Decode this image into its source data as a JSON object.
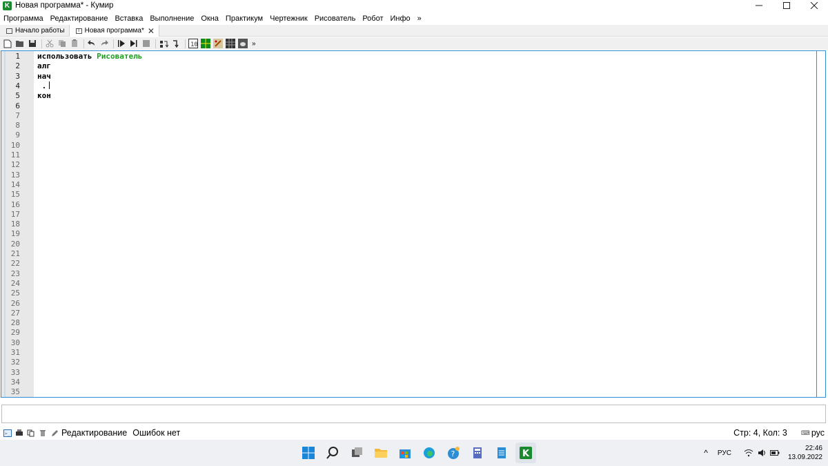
{
  "window": {
    "title": "Новая программа* - Кумир",
    "app_icon_letter": "K"
  },
  "menu": [
    "Программа",
    "Редактирование",
    "Вставка",
    "Выполнение",
    "Окна",
    "Практикум",
    "Чертежник",
    "Рисователь",
    "Робот",
    "Инфо",
    "»"
  ],
  "tabs": [
    {
      "label": "Начало работы",
      "active": false
    },
    {
      "label": "Новая программа*",
      "active": true
    }
  ],
  "toolbar": {
    "more": "»"
  },
  "editor": {
    "line_count": 35,
    "lines": [
      {
        "kw": "использовать",
        "mod": "Рисователь"
      },
      {
        "kw": "алг",
        "mod": ""
      },
      {
        "kw": "нач",
        "mod": ""
      },
      {
        "kw": " .",
        "mod": ""
      },
      {
        "kw": "кон",
        "mod": ""
      }
    ]
  },
  "status": {
    "mode": "Редактирование",
    "errors": "Ошибок нет",
    "position": "Стр: 4, Кол: 3",
    "lang": "рус"
  },
  "taskbar": {
    "input_lang": "РУС",
    "time": "22:46",
    "date": "13.09.2022"
  },
  "colors": {
    "accent": "#2b8ed6",
    "module": "#1aa01a",
    "kumir_green": "#1a8a2e"
  }
}
